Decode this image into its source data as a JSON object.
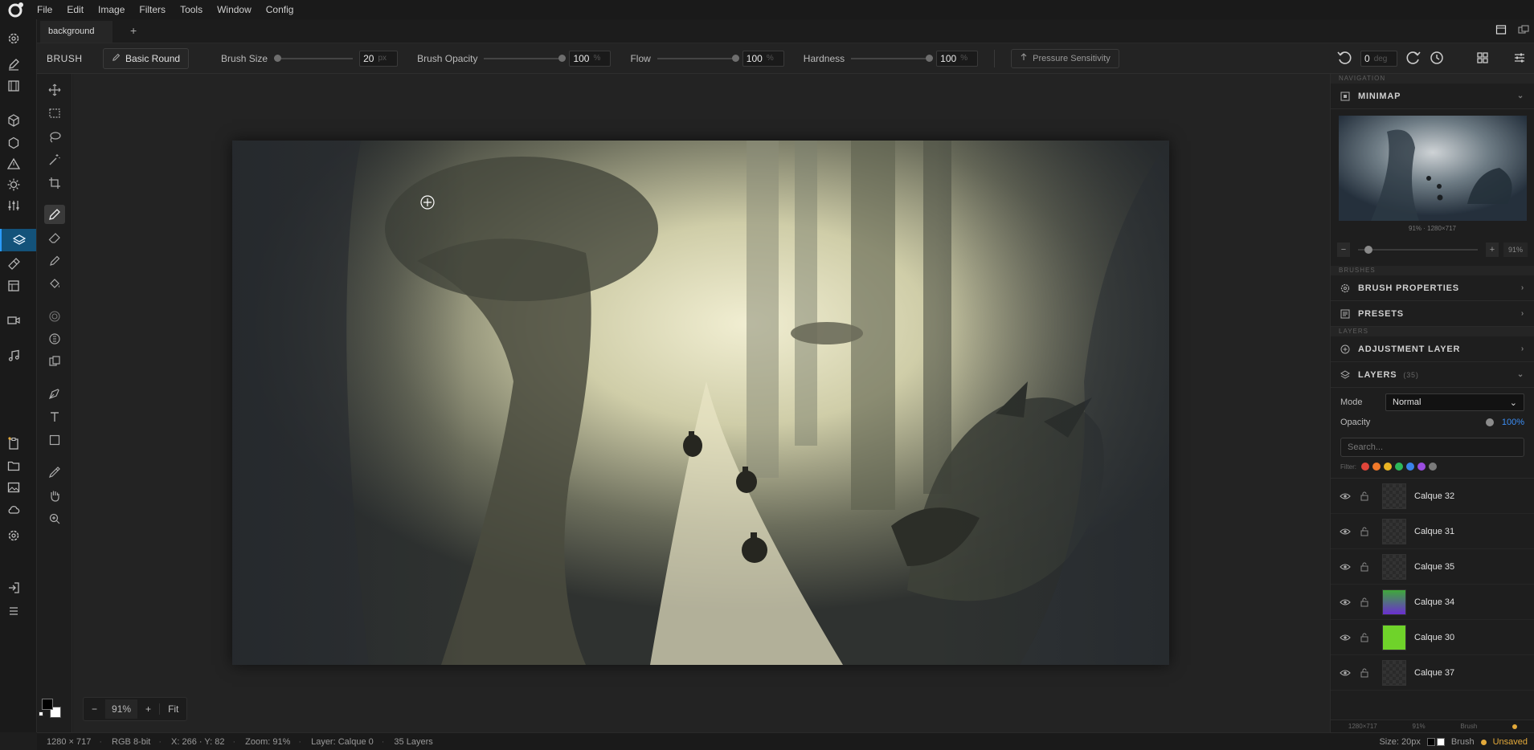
{
  "menubar": {
    "items": [
      "File",
      "Edit",
      "Image",
      "Filters",
      "Tools",
      "Window",
      "Config"
    ]
  },
  "tabs": {
    "active": "background",
    "add": "+"
  },
  "options": {
    "title": "BRUSH",
    "preset": "Basic Round",
    "size_label": "Brush Size",
    "size_value": "20",
    "size_unit": "px",
    "size_fraction": 0.02,
    "opacity_label": "Brush Opacity",
    "opacity_value": "100",
    "opacity_unit": "%",
    "opacity_fraction": 1.0,
    "flow_label": "Flow",
    "flow_value": "100",
    "flow_unit": "%",
    "flow_fraction": 1.0,
    "hardness_label": "Hardness",
    "hardness_value": "100",
    "hardness_unit": "%",
    "hardness_fraction": 1.0,
    "pressure_label": "Pressure Sensitivity",
    "rotation_value": "0",
    "rotation_unit": "deg"
  },
  "zoombar": {
    "minus": "−",
    "value": "91%",
    "plus": "+",
    "fit": "Fit"
  },
  "panel": {
    "navigation_section": "NAVIGATION",
    "minimap_title": "MINIMAP",
    "minimap_caption": "91% · 1280×717",
    "minimap_zoom": "91%",
    "minimap_minus": "−",
    "minimap_plus": "+",
    "brushes_section": "BRUSHES",
    "brush_properties": "BRUSH PROPERTIES",
    "presets": "PRESETS",
    "layers_section": "LAYERS",
    "adjustment_layer": "ADJUSTMENT LAYER",
    "layers_title": "LAYERS",
    "layers_count": "(35)",
    "mode_label": "Mode",
    "mode_value": "Normal",
    "opacity_label": "Opacity",
    "opacity_value": "100%",
    "search_placeholder": "Search...",
    "filter_label": "Filter:",
    "filter_colors": [
      "#e0453a",
      "#f0792a",
      "#e9b424",
      "#2db85a",
      "#3a82e8",
      "#9b4de0",
      "#7a7a7a"
    ],
    "layers": [
      {
        "name": "Calque 32",
        "thumb": "checker"
      },
      {
        "name": "Calque 31",
        "thumb": "checker"
      },
      {
        "name": "Calque 35",
        "thumb": "checker"
      },
      {
        "name": "Calque 34",
        "thumb": "gradient"
      },
      {
        "name": "Calque 30",
        "thumb": "green"
      },
      {
        "name": "Calque 37",
        "thumb": "checker"
      }
    ],
    "status": [
      "1280×717",
      "91%",
      "Brush"
    ]
  },
  "statusbar": {
    "dimensions": "1280 × 717",
    "mode": "RGB 8-bit",
    "coords": "X: 266 · Y: 82",
    "zoom": "Zoom: 91%",
    "layer": "Layer: Calque 0",
    "layers": "35 Layers",
    "size": "Size: 20px",
    "tool": "Brush",
    "unsaved": "Unsaved"
  },
  "colors": {
    "accent": "#2b9bff",
    "unsaved": "#e3a93a",
    "layer34_gradient": [
      "#3fa83a",
      "#6a2fd0"
    ],
    "layer30_fill": "#6fd32a"
  }
}
